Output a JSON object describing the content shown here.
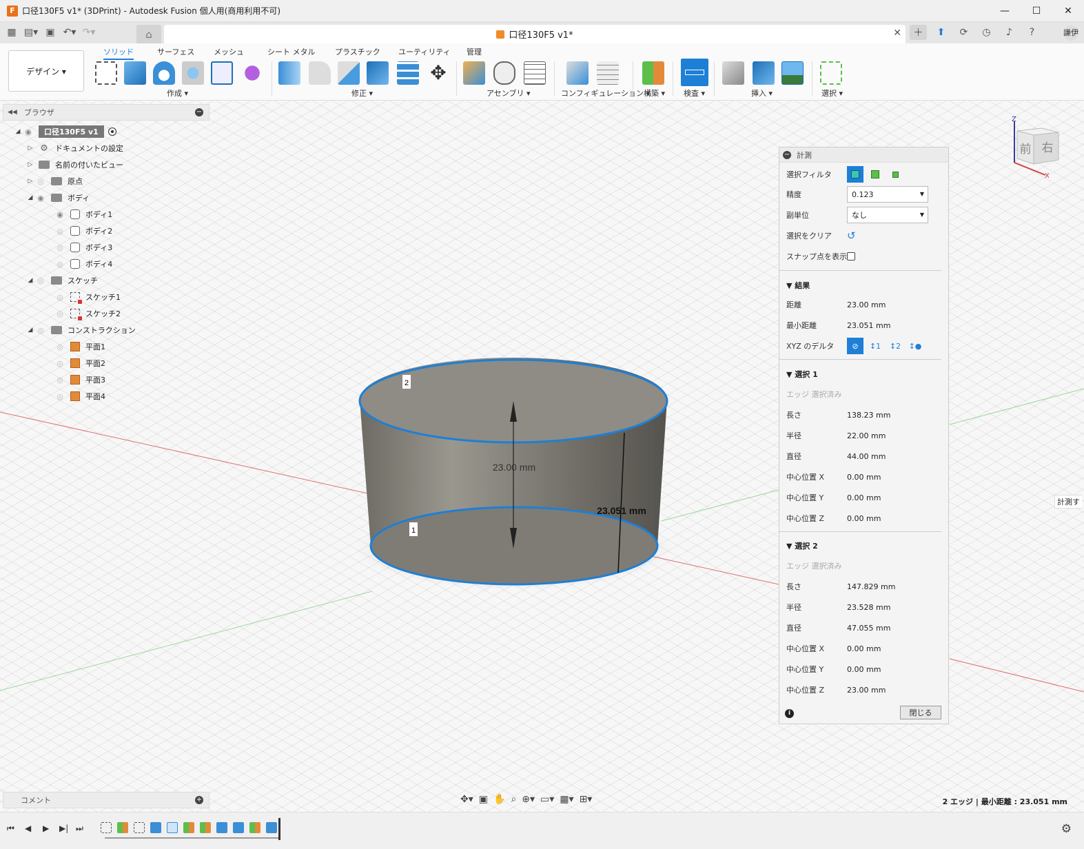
{
  "window": {
    "title": "口径130F5 v1* (3DPrint) - Autodesk Fusion 個人用(商用利用不可)",
    "app_icon": "F",
    "minimize": "—",
    "maximize": "☐",
    "close": "✕"
  },
  "tabstrip": {
    "doc_tab": "口径130F5 v1*",
    "user_initials": "謙伊",
    "close": "✕"
  },
  "ribbon": {
    "workspace": "デザイン ▾",
    "tabs": [
      "ソリッド",
      "サーフェス",
      "メッシュ",
      "シート メタル",
      "プラスチック",
      "ユーティリティ",
      "管理"
    ],
    "groups": [
      "作成 ▾",
      "修正 ▾",
      "アセンブリ ▾",
      "コンフィギュレーション ▾",
      "構築 ▾",
      "検査 ▾",
      "挿入 ▾",
      "選択 ▾"
    ]
  },
  "browser": {
    "title": "ブラウザ",
    "root": "口径130F5 v1",
    "items": [
      {
        "label": "ドキュメントの設定"
      },
      {
        "label": "名前の付いたビュー"
      },
      {
        "label": "原点"
      },
      {
        "label": "ボディ"
      },
      {
        "label": "ボディ1"
      },
      {
        "label": "ボディ2"
      },
      {
        "label": "ボディ3"
      },
      {
        "label": "ボディ4"
      },
      {
        "label": "スケッチ"
      },
      {
        "label": "スケッチ1"
      },
      {
        "label": "スケッチ2"
      },
      {
        "label": "コンストラクション"
      },
      {
        "label": "平面1"
      },
      {
        "label": "平面2"
      },
      {
        "label": "平面3"
      },
      {
        "label": "平面4"
      }
    ]
  },
  "viewport": {
    "dim_height": "23.00 mm",
    "dim_min": "23.051 mm",
    "label_1": "1",
    "label_2": "2",
    "viewcube_front": "前",
    "viewcube_right": "右",
    "axis_z": "Z",
    "axis_x": "X"
  },
  "measure": {
    "title": "計測",
    "filter_label": "選択フィルタ",
    "precision_label": "精度",
    "precision_value": "0.123",
    "subunit_label": "副単位",
    "subunit_value": "なし",
    "clear_label": "選択をクリア",
    "snap_label": "スナップ点を表示",
    "results_title": "結果",
    "distance_label": "距離",
    "distance_value": "23.00 mm",
    "min_distance_label": "最小距離",
    "min_distance_value": "23.051 mm",
    "xyz_delta_label": "XYZ のデルタ",
    "sel1": {
      "title": "選択 1",
      "state": "エッジ 選択済み",
      "rows": [
        {
          "k": "長さ",
          "v": "138.23 mm"
        },
        {
          "k": "半径",
          "v": "22.00 mm"
        },
        {
          "k": "直径",
          "v": "44.00 mm"
        },
        {
          "k": "中心位置 X",
          "v": "0.00 mm"
        },
        {
          "k": "中心位置 Y",
          "v": "0.00 mm"
        },
        {
          "k": "中心位置 Z",
          "v": "0.00 mm"
        }
      ]
    },
    "sel2": {
      "title": "選択 2",
      "state": "エッジ 選択済み",
      "rows": [
        {
          "k": "長さ",
          "v": "147.829 mm"
        },
        {
          "k": "半径",
          "v": "23.528 mm"
        },
        {
          "k": "直径",
          "v": "47.055 mm"
        },
        {
          "k": "中心位置 X",
          "v": "0.00 mm"
        },
        {
          "k": "中心位置 Y",
          "v": "0.00 mm"
        },
        {
          "k": "中心位置 Z",
          "v": "23.00 mm"
        }
      ]
    },
    "close_label": "閉じる"
  },
  "side_tab": "計測す",
  "comments": {
    "title": "コメント"
  },
  "status": "2 エッジ | 最小距離 : 23.051 mm",
  "colors": {
    "accent": "#1e7fd6",
    "model_gray": "#8c8a82",
    "orange": "#e38a3a"
  }
}
